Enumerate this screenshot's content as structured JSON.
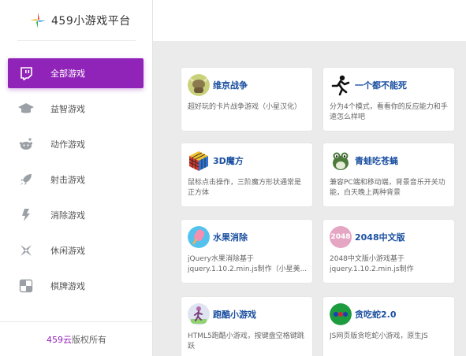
{
  "brand": {
    "title": "459小游戏平台",
    "logo_icon": "pinwheel-star-icon"
  },
  "nav": [
    {
      "label": "全部游戏",
      "icon": "twitch-icon",
      "active": true
    },
    {
      "label": "益智游戏",
      "icon": "graduation-cap-icon",
      "active": false
    },
    {
      "label": "动作游戏",
      "icon": "reddit-alien-icon",
      "active": false
    },
    {
      "label": "射击游戏",
      "icon": "rocket-icon",
      "active": false
    },
    {
      "label": "消除游戏",
      "icon": "lightning-bolt-icon",
      "active": false
    },
    {
      "label": "休闲游戏",
      "icon": "shuriken-icon",
      "active": false
    },
    {
      "label": "棋牌游戏",
      "icon": "checkerboard-icon",
      "active": false
    }
  ],
  "footer": {
    "brand": "459云",
    "suffix": "版权所有"
  },
  "colors": {
    "accent": "#9124b8",
    "title_blue": "#1a4fa0",
    "background": "#ebebeb"
  },
  "games": [
    {
      "name": "维京战争",
      "desc": "超好玩的卡片战争游戏（小星汉化）",
      "icon": "viking-helmet-icon"
    },
    {
      "name": "一个都不能死",
      "desc": "分为4个模式，看看你的反应能力和手速怎么样吧",
      "icon": "running-man-icon"
    },
    {
      "name": "3D魔方",
      "desc": "鼠标点击操作，三阶魔方形状通常是正方体",
      "icon": "rubiks-cube-icon"
    },
    {
      "name": "青蛙吃苍蝇",
      "desc": "兼容PC端和移动端，背景音乐开关功能，白天晚上两种背景",
      "icon": "frog-icon"
    },
    {
      "name": "水果消除",
      "desc": "jQuery水果消除基于jquery.1.10.2.min.js制作（小星美...",
      "icon": "popsicle-icon"
    },
    {
      "name": "2048中文版",
      "desc": "2048中文版小游戏基于jquery.1.10.2.min.js制作",
      "icon": "2048-tile-icon",
      "tile_text": "2048"
    },
    {
      "name": "跑酷小游戏",
      "desc": "HTML5跑酷小游戏，按键盘空格键跳跃",
      "icon": "parkour-runner-icon"
    },
    {
      "name": "贪吃蛇2.0",
      "desc": "JS网页版贪吃蛇小游戏，原生JS",
      "icon": "snake-dots-icon"
    }
  ]
}
